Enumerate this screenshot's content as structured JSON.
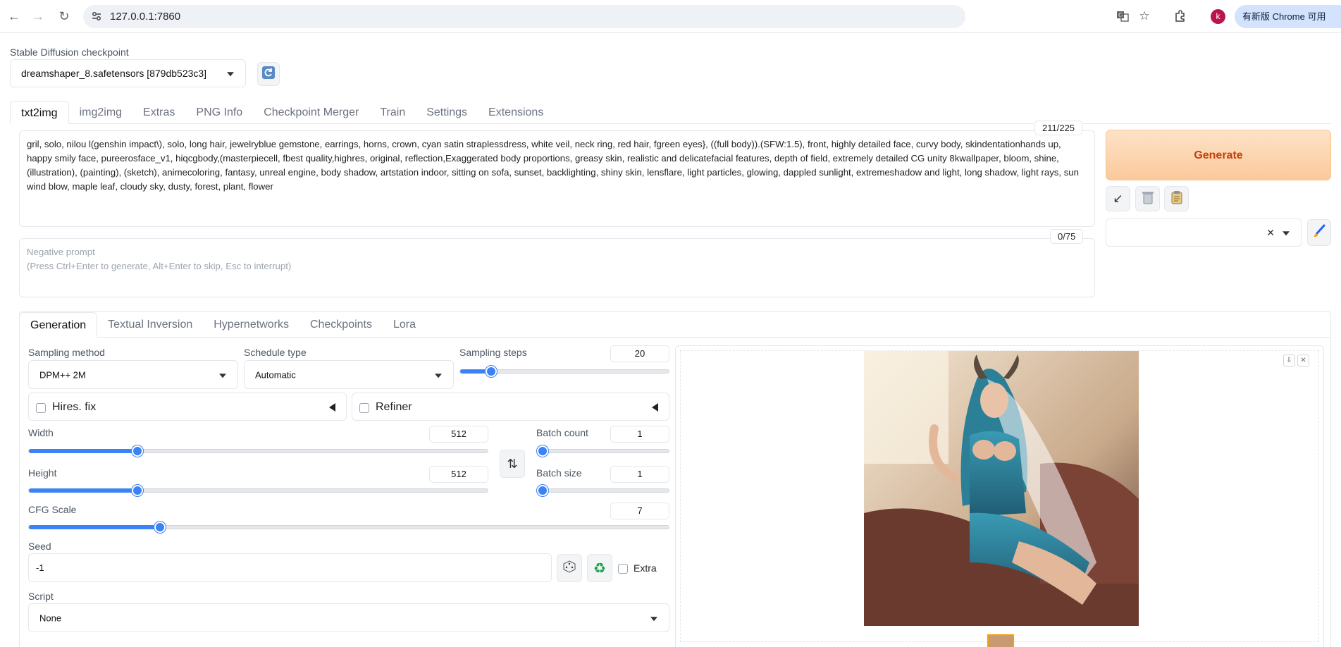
{
  "browser": {
    "url": "127.0.0.1:7860",
    "avatar_letter": "k",
    "update_label": "有新版 Chrome 可用"
  },
  "checkpoint": {
    "label": "Stable Diffusion checkpoint",
    "value": "dreamshaper_8.safetensors [879db523c3]"
  },
  "main_tabs": [
    "txt2img",
    "img2img",
    "Extras",
    "PNG Info",
    "Checkpoint Merger",
    "Train",
    "Settings",
    "Extensions"
  ],
  "prompt": {
    "text": "gril, solo, nilou l(genshin impact\\), solo, long hair, jewelryblue gemstone, earrings, horns, crown, cyan satin straplessdress, white veil, neck ring, red hair, fgreen eyes}, ((full body)).(SFW:1.5), front, highly detailed face, curvy body, skindentationhands up, happy smily face, pureerosface_v1, hiqcgbody,(masterpiecell, fbest quality,highres, original, reflection,Exaggerated body proportions, greasy skin, realistic and delicatefacial features, depth of field, extremely detailed CG unity 8kwallpaper, bloom, shine, (illustration), (painting), (sketch), animecoloring, fantasy, unreal engine, body shadow, artstation indoor, sitting on sofa, sunset, backlighting, shiny skin, lensflare, light particles, glowing, dappled sunlight, extremeshadow and light, long shadow, light rays, sun wind blow, maple leaf, cloudy sky, dusty, forest, plant, flower",
    "count": "211/225"
  },
  "negative": {
    "placeholder": "Negative prompt\n(Press Ctrl+Enter to generate, Alt+Enter to skip, Esc to interrupt)",
    "count": "0/75"
  },
  "generate_label": "Generate",
  "sub_tabs": [
    "Generation",
    "Textual Inversion",
    "Hypernetworks",
    "Checkpoints",
    "Lora"
  ],
  "settings": {
    "sampling_method_label": "Sampling method",
    "sampling_method": "DPM++ 2M",
    "schedule_type_label": "Schedule type",
    "schedule_type": "Automatic",
    "sampling_steps_label": "Sampling steps",
    "sampling_steps": "20",
    "hires_label": "Hires. fix",
    "refiner_label": "Refiner",
    "width_label": "Width",
    "width": "512",
    "height_label": "Height",
    "height": "512",
    "batch_count_label": "Batch count",
    "batch_count": "1",
    "batch_size_label": "Batch size",
    "batch_size": "1",
    "cfg_label": "CFG Scale",
    "cfg": "7",
    "seed_label": "Seed",
    "seed": "-1",
    "extra_label": "Extra",
    "script_label": "Script",
    "script": "None"
  },
  "slider_levels": {
    "sampling_steps": 0.13,
    "width": 0.23,
    "height": 0.23,
    "batch_count": 0.0,
    "batch_size": 0.0,
    "cfg": 0.2
  },
  "colors": {
    "accent": "#3b82f6",
    "generate_text": "#c2410c"
  }
}
